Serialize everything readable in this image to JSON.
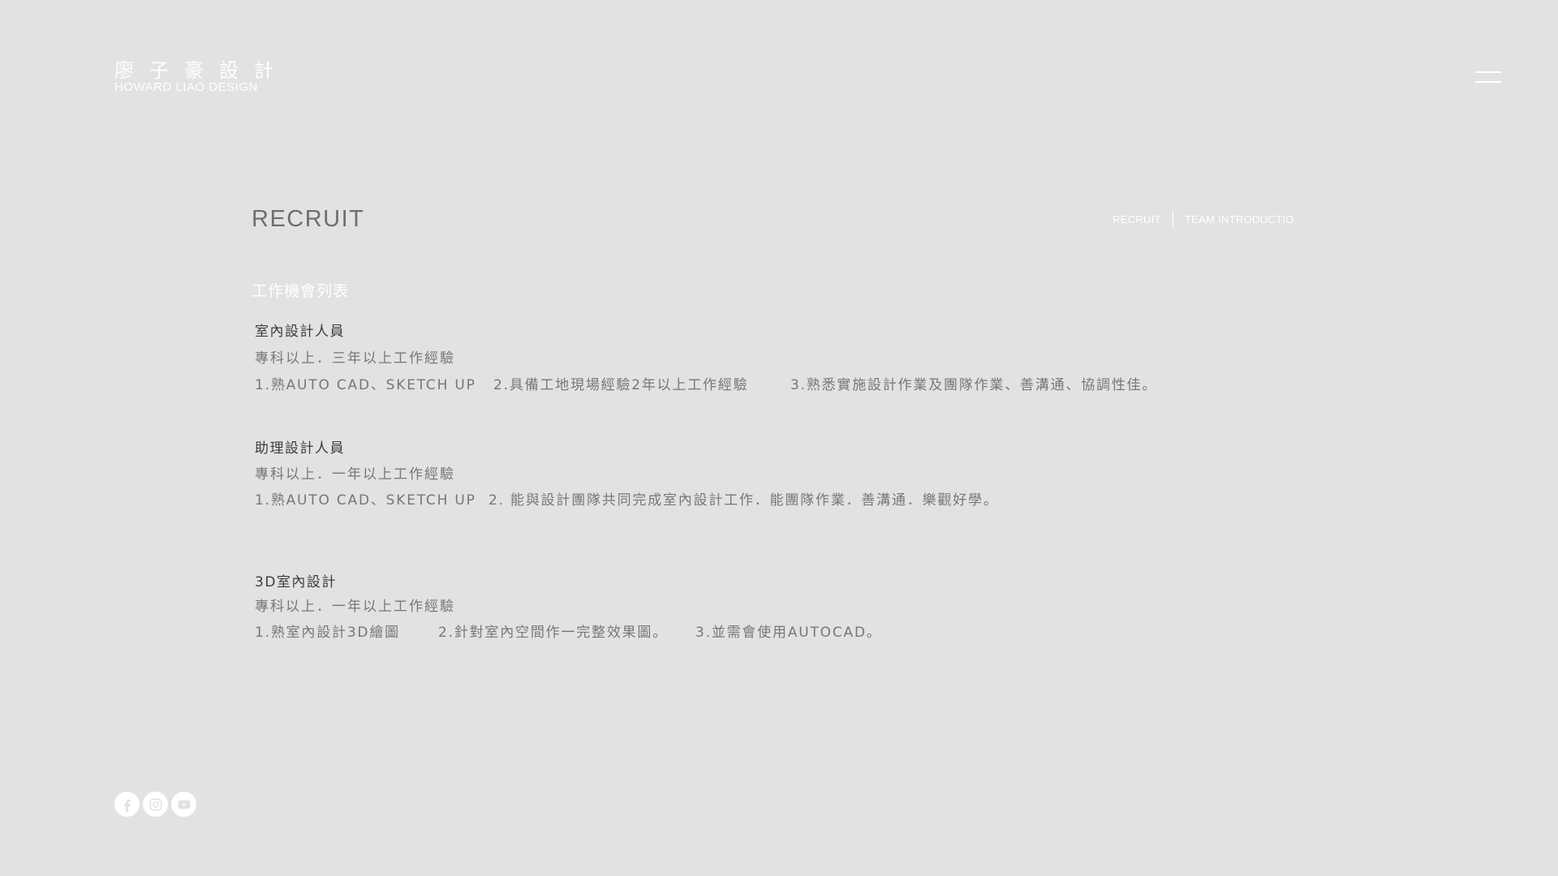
{
  "logo": {
    "chinese": "廖子豪設計",
    "english": "HOWARD LIAO DESIGN"
  },
  "header": {
    "page_title": "RECRUIT",
    "subnav": [
      {
        "label": "RECRUIT"
      },
      {
        "label": "TEAM INTRODUCTIO"
      }
    ]
  },
  "section_title": "工作機會列表",
  "jobs": [
    {
      "title": "室內設計人員",
      "education": "專科以上．三年以上工作經驗",
      "requirements": [
        "1.熟AUTO CAD、SKETCH UP",
        "2.具備工地現場經驗2年以上工作經驗",
        "3.熟悉實施設計作業及團隊作業、善溝通、協調性佳。"
      ]
    },
    {
      "title": "助理設計人員",
      "education": "專科以上．一年以上工作經驗",
      "requirements": [
        "1.熟AUTO CAD、SKETCH UP",
        "2. 能與設計團隊共同完成室內設計工作．能團隊作業．善溝通．樂觀好學。"
      ]
    },
    {
      "title": "3D室內設計",
      "education": "專科以上．一年以上工作經驗",
      "requirements": [
        "1.熟室內設計3D繪圖",
        "2.針對室內空間作一完整效果圖。",
        "3.並需會使用AUTOCAD。"
      ]
    }
  ],
  "social": [
    {
      "icon": "facebook-icon"
    },
    {
      "icon": "instagram-icon"
    },
    {
      "icon": "youtube-icon"
    }
  ],
  "colors": {
    "background": "#e2e2e2",
    "white": "#ffffff",
    "title_text": "#3c3c3c",
    "body_text": "#777777",
    "social_icon": "#e2e2e2"
  }
}
